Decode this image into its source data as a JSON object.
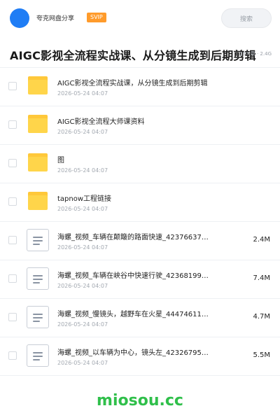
{
  "header": {
    "brand": "夸克网盘分享",
    "badge": "SVIP",
    "search_placeholder": "搜索"
  },
  "folder": {
    "title": "AIGC影视全流程实战课、从分镜生成到后期剪辑",
    "meta": "157 项 · 2.4G"
  },
  "items": [
    {
      "type": "folder",
      "name": "AIGC影视全流程实战课，从分镜生成到后期剪辑",
      "date": "2026-05-24 04:07",
      "size": ""
    },
    {
      "type": "folder",
      "name": "AIGC影视全流程大师课资料",
      "date": "2026-05-24 04:07",
      "size": ""
    },
    {
      "type": "folder",
      "name": "图",
      "date": "2026-05-24 04:07",
      "size": ""
    },
    {
      "type": "folder",
      "name": "tapnow工程链接",
      "date": "2026-05-24 04:07",
      "size": ""
    },
    {
      "type": "file",
      "name": "海螺_视频_车辆在颠簸的路面快速_42376637…",
      "date": "2026-05-24 04:07",
      "size": "2.4M"
    },
    {
      "type": "file",
      "name": "海螺_视频_车辆在峡谷中快速行驶_42368199…",
      "date": "2026-05-24 04:07",
      "size": "7.4M"
    },
    {
      "type": "file",
      "name": "海螺_视频_慢镜头，越野车在火星_44474611…",
      "date": "2026-05-24 04:07",
      "size": "4.7M"
    },
    {
      "type": "file",
      "name": "海螺_视频_以车辆为中心，镜头左_42326795…",
      "date": "2026-05-24 04:07",
      "size": "5.5M"
    }
  ],
  "watermark": "miosou.cc",
  "colors": {
    "accent": "#1f7df5",
    "badge": "#ff9b2b",
    "folder": "#ffd54a",
    "watermark": "#2fbf4a"
  },
  "icons": {
    "folder": "folder-icon",
    "file": "video-file-icon"
  }
}
